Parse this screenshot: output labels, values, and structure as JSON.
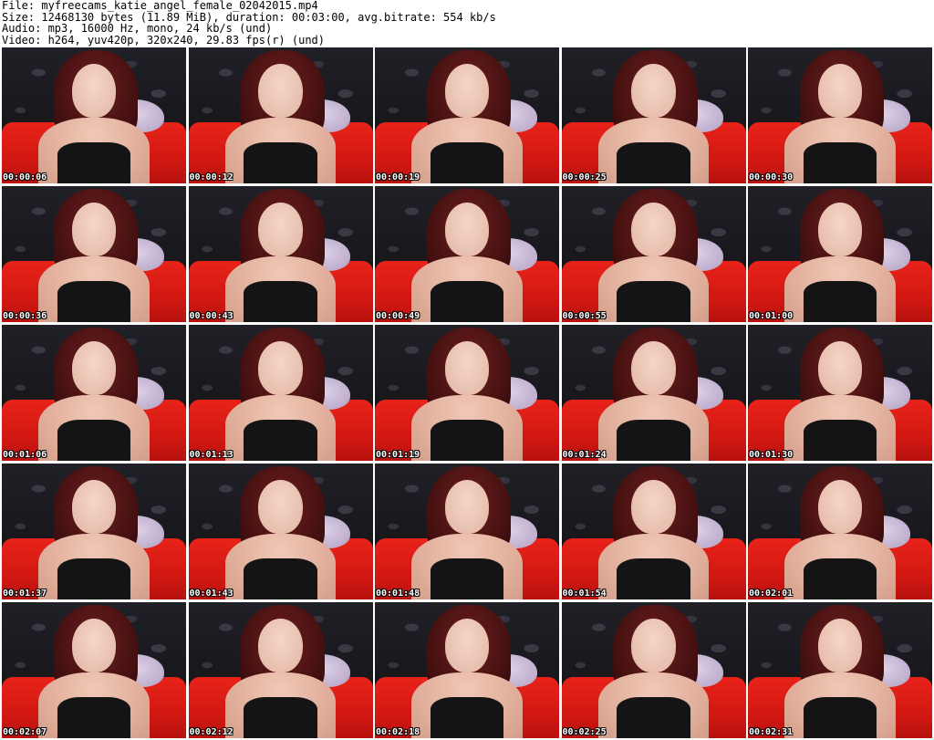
{
  "header": {
    "file": "File: myfreecams_katie_angel_female_02042015.mp4",
    "size": "Size: 12468130 bytes (11.89 MiB), duration: 00:03:00, avg.bitrate: 554 kb/s",
    "audio": "Audio: mp3, 16000 Hz, mono, 24 kb/s (und)",
    "video": "Video: h264, yuv420p, 320x240, 29.83 fps(r) (und)"
  },
  "thumbnails": [
    {
      "timestamp": "00:00:06"
    },
    {
      "timestamp": "00:00:12"
    },
    {
      "timestamp": "00:00:19"
    },
    {
      "timestamp": "00:00:25"
    },
    {
      "timestamp": "00:00:30"
    },
    {
      "timestamp": "00:00:36"
    },
    {
      "timestamp": "00:00:43"
    },
    {
      "timestamp": "00:00:49"
    },
    {
      "timestamp": "00:00:55"
    },
    {
      "timestamp": "00:01:00"
    },
    {
      "timestamp": "00:01:06"
    },
    {
      "timestamp": "00:01:13"
    },
    {
      "timestamp": "00:01:19"
    },
    {
      "timestamp": "00:01:24"
    },
    {
      "timestamp": "00:01:30"
    },
    {
      "timestamp": "00:01:37"
    },
    {
      "timestamp": "00:01:43"
    },
    {
      "timestamp": "00:01:48"
    },
    {
      "timestamp": "00:01:54"
    },
    {
      "timestamp": "00:02:01"
    },
    {
      "timestamp": "00:02:07"
    },
    {
      "timestamp": "00:02:12"
    },
    {
      "timestamp": "00:02:18"
    },
    {
      "timestamp": "00:02:25"
    },
    {
      "timestamp": "00:02:31"
    }
  ]
}
